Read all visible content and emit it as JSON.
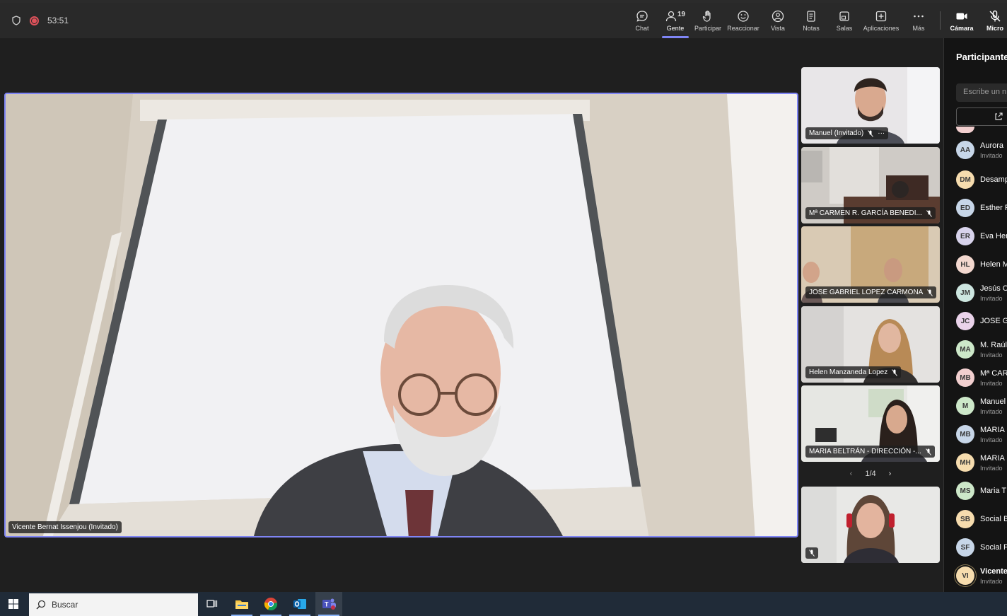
{
  "topbar": {
    "timer": "53:51",
    "people_count": "19",
    "tools": [
      {
        "label": "Chat",
        "icon": "chat-icon"
      },
      {
        "label": "Gente",
        "icon": "people-icon"
      },
      {
        "label": "Participar",
        "icon": "raise-hand-icon"
      },
      {
        "label": "Reaccionar",
        "icon": "react-icon"
      },
      {
        "label": "Vista",
        "icon": "view-icon"
      },
      {
        "label": "Notas",
        "icon": "notes-icon"
      },
      {
        "label": "Salas",
        "icon": "rooms-icon"
      },
      {
        "label": "Aplicaciones",
        "icon": "apps-icon"
      },
      {
        "label": "Más",
        "icon": "more-icon"
      },
      {
        "label": "Cámara",
        "icon": "camera-icon"
      },
      {
        "label": "Micro",
        "icon": "mic-icon"
      }
    ]
  },
  "main_video": {
    "name": "Vicente Bernat Issenjou (Invitado)"
  },
  "tiles": [
    {
      "name": "Manuel (Invitado)"
    },
    {
      "name": "Mª CARMEN R. GARCÍA BENEDI..."
    },
    {
      "name": "JOSE GABRIEL LOPEZ CARMONA"
    },
    {
      "name": "Helen Manzaneda Lopez"
    },
    {
      "name": "MARIA BELTRÁN - DIRECCIÓN -..."
    },
    {
      "name": ""
    }
  ],
  "pager": {
    "label": "1/4"
  },
  "panel": {
    "title": "Participantes",
    "search_placeholder": "Escribe un n",
    "participants": [
      {
        "initials": "AA",
        "name": "Aurora",
        "sub": "Invitado",
        "color": "#c7d6e8"
      },
      {
        "initials": "DM",
        "name": "Desamp",
        "sub": "",
        "color": "#f6dcae"
      },
      {
        "initials": "ED",
        "name": "Esther F",
        "sub": "",
        "color": "#c7d6e8"
      },
      {
        "initials": "ER",
        "name": "Eva Her",
        "sub": "",
        "color": "#d8d3ec"
      },
      {
        "initials": "HL",
        "name": "Helen M",
        "sub": "",
        "color": "#f3d8cf"
      },
      {
        "initials": "JM",
        "name": "Jesús C",
        "sub": "Invitado",
        "color": "#cde6e0"
      },
      {
        "initials": "JC",
        "name": "JOSE G",
        "sub": "",
        "color": "#ead3ea"
      },
      {
        "initials": "MA",
        "name": "M. Raúl",
        "sub": "Invitado",
        "color": "#cde8c9"
      },
      {
        "initials": "MB",
        "name": "Mª CAR",
        "sub": "Invitado",
        "color": "#f2cfcf"
      },
      {
        "initials": "M",
        "name": "Manuel",
        "sub": "Invitado",
        "color": "#cde8c9"
      },
      {
        "initials": "MB",
        "name": "MARIA",
        "sub": "Invitado",
        "color": "#c7d6e8"
      },
      {
        "initials": "MH",
        "name": "MARIA",
        "sub": "Invitado",
        "color": "#f6dcae"
      },
      {
        "initials": "MS",
        "name": "Maria T",
        "sub": "",
        "color": "#cde8c9"
      },
      {
        "initials": "SB",
        "name": "Social B",
        "sub": "",
        "color": "#f6dcae"
      },
      {
        "initials": "SF",
        "name": "Social F",
        "sub": "",
        "color": "#c7d6e8"
      },
      {
        "initials": "VI",
        "name": "Vicente",
        "sub": "Invitado",
        "color": "#f6dcae"
      }
    ]
  },
  "taskbar": {
    "search_label": "Buscar"
  }
}
